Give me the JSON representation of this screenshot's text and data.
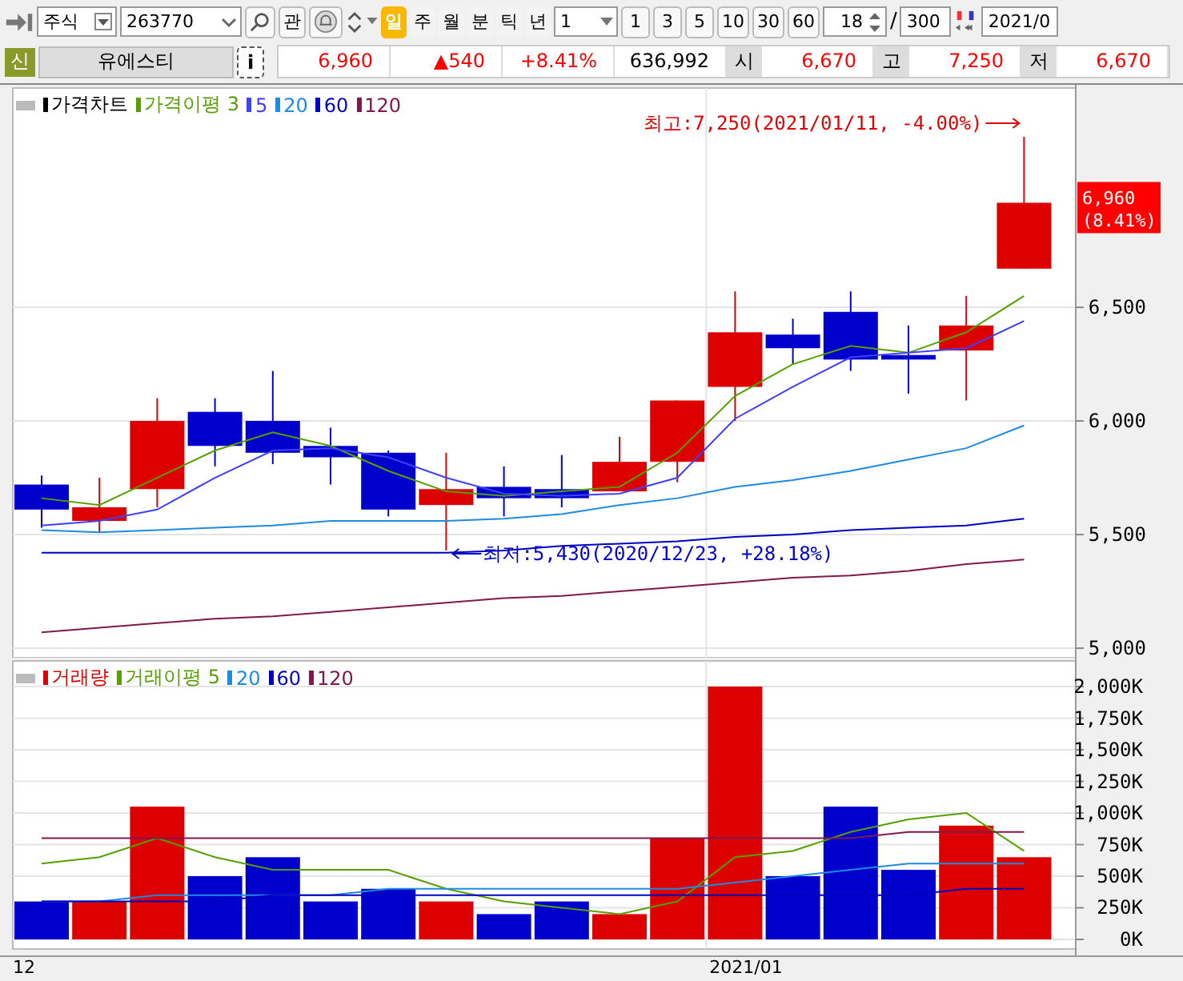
{
  "toolbar": {
    "market": "주식",
    "code": "263770",
    "watch_button": "관",
    "periods": [
      {
        "label": "일",
        "selected": true
      },
      {
        "label": "주",
        "selected": false
      },
      {
        "label": "월",
        "selected": false
      },
      {
        "label": "분",
        "selected": false
      },
      {
        "label": "틱",
        "selected": false
      },
      {
        "label": "년",
        "selected": false
      }
    ],
    "interval": "1",
    "multipliers": [
      "1",
      "3",
      "5",
      "10",
      "30",
      "60"
    ],
    "count": "18",
    "separator": "/",
    "total": "300",
    "date": "2021/0"
  },
  "quote": {
    "badge": "신",
    "name": "유에스티",
    "info": "i",
    "cells": [
      {
        "kind": "value",
        "text": "6,960",
        "color": "#ff0000"
      },
      {
        "kind": "value",
        "text": "▲540",
        "color": "#ff0000"
      },
      {
        "kind": "value",
        "text": "+8.41%",
        "color": "#ff0000"
      },
      {
        "kind": "value",
        "text": "636,992",
        "color": "#000000"
      },
      {
        "kind": "label",
        "text": "시",
        "color": "#000000"
      },
      {
        "kind": "value",
        "text": "6,670",
        "color": "#ff0000"
      },
      {
        "kind": "label",
        "text": "고",
        "color": "#000000"
      },
      {
        "kind": "value",
        "text": "7,250",
        "color": "#ff0000"
      },
      {
        "kind": "label",
        "text": "저",
        "color": "#000000"
      },
      {
        "kind": "value",
        "text": "6,670",
        "color": "#ff0000"
      }
    ]
  },
  "price_panel": {
    "title": "가격차트",
    "candles": [
      {
        "rising": false
      },
      {
        "rising": true
      },
      {
        "rising": true
      },
      {
        "rising": false
      },
      {
        "rising": false
      },
      {
        "rising": false
      },
      {
        "rising": false
      },
      {
        "rising": true
      },
      {
        "rising": false
      },
      {
        "rising": false
      },
      {
        "rising": true
      },
      {
        "rising": true
      },
      {
        "rising": true
      },
      {
        "rising": false
      },
      {
        "rising": false
      },
      {
        "rising": false
      },
      {
        "rising": true
      },
      {
        "rising": true
      }
    ],
    "last_price": [
      "6,960",
      "(8.41%)"
    ],
    "chart_data": {
      "type": "line",
      "grid": true,
      "ylim": [
        4958,
        7479
      ],
      "yticks": [
        {
          "value": 5000,
          "label": "5,000"
        },
        {
          "value": 5500,
          "label": "5,500"
        },
        {
          "value": 6000,
          "label": "6,000"
        },
        {
          "value": 6500,
          "label": "6,500"
        }
      ],
      "series": [
        {
          "name": "가격이평 3",
          "color": "#55a000",
          "values": [
            5660,
            5630,
            5750,
            5870,
            5950,
            5890,
            5780,
            5690,
            5670,
            5690,
            5710,
            5860,
            6110,
            6250,
            6330,
            6300,
            6390,
            6550
          ]
        },
        {
          "name": "5",
          "color": "#4040ff",
          "values": [
            5540,
            5560,
            5610,
            5750,
            5870,
            5880,
            5840,
            5750,
            5680,
            5670,
            5680,
            5750,
            6010,
            6150,
            6280,
            6300,
            6320,
            6440
          ]
        },
        {
          "name": "20",
          "color": "#1e8ae0",
          "values": [
            5520,
            5510,
            5520,
            5530,
            5540,
            5560,
            5560,
            5560,
            5570,
            5590,
            5630,
            5660,
            5710,
            5740,
            5780,
            5830,
            5880,
            5980
          ]
        },
        {
          "name": "60",
          "color": "#0000c0",
          "values": [
            5420,
            5420,
            5420,
            5420,
            5420,
            5420,
            5420,
            5420,
            5430,
            5450,
            5460,
            5470,
            5490,
            5500,
            5520,
            5530,
            5540,
            5570
          ]
        },
        {
          "name": "120",
          "color": "#801850",
          "values": [
            5070,
            5090,
            5110,
            5130,
            5140,
            5160,
            5180,
            5200,
            5220,
            5230,
            5250,
            5270,
            5290,
            5310,
            5320,
            5340,
            5370,
            5390
          ]
        }
      ],
      "annotations": [
        {
          "text": "최고:7,250(2021/01/11, -4.00%)"
        },
        {
          "text": "최저:5,430(2020/12/23, +28.18%)"
        }
      ]
    }
  },
  "volume_panel": {
    "bars": {
      "chart_data": {
        "type": "bar",
        "grid": true,
        "ylim": [
          -76,
          2228
        ],
        "yticks": [
          {
            "value": 0,
            "label": "0K"
          },
          {
            "value": 250,
            "label": "250K"
          },
          {
            "value": 500,
            "label": "500K"
          },
          {
            "value": 750,
            "label": "750K"
          },
          {
            "value": 1000,
            "label": "1,000K"
          },
          {
            "value": 1250,
            "label": "1,250K"
          },
          {
            "value": 1500,
            "label": "1,500K"
          },
          {
            "value": 1750,
            "label": "1,750K"
          },
          {
            "value": 2000,
            "label": "2,000K"
          }
        ],
        "series": [
          {
            "name": "거래량",
            "color": "#dd0000",
            "values": [
              null,
              300,
              1050,
              null,
              null,
              null,
              null,
              300,
              null,
              null,
              200,
              800,
              2000,
              null,
              null,
              null,
              900,
              650
            ]
          },
          {
            "color": "#0000cc",
            "values": [
              300,
              null,
              null,
              500,
              650,
              300,
              400,
              null,
              200,
              300,
              null,
              null,
              null,
              500,
              1050,
              550,
              null,
              null
            ]
          }
        ]
      }
    },
    "averages": {
      "chart_data": {
        "type": "line",
        "ylim": [
          -76,
          2228
        ],
        "series": [
          {
            "name": "거래이평 5",
            "color": "#55a000",
            "values": [
              600,
              650,
              800,
              650,
              550,
              550,
              550,
              400,
              300,
              250,
              200,
              300,
              650,
              700,
              850,
              950,
              1000,
              700
            ]
          },
          {
            "name": "20",
            "color": "#1e8ae0",
            "values": [
              300,
              300,
              350,
              350,
              350,
              350,
              400,
              400,
              400,
              400,
              400,
              400,
              450,
              500,
              550,
              600,
              600,
              600
            ]
          },
          {
            "name": "60",
            "color": "#0000c0",
            "values": [
              300,
              300,
              300,
              300,
              350,
              350,
              350,
              350,
              350,
              350,
              350,
              350,
              350,
              350,
              350,
              350,
              400,
              400
            ]
          },
          {
            "name": "120",
            "color": "#801850",
            "values": [
              800,
              800,
              800,
              800,
              800,
              800,
              800,
              800,
              800,
              800,
              800,
              800,
              800,
              800,
              800,
              850,
              850,
              850
            ]
          }
        ]
      }
    },
    "x_labels": [
      "12",
      "2021/01"
    ]
  }
}
